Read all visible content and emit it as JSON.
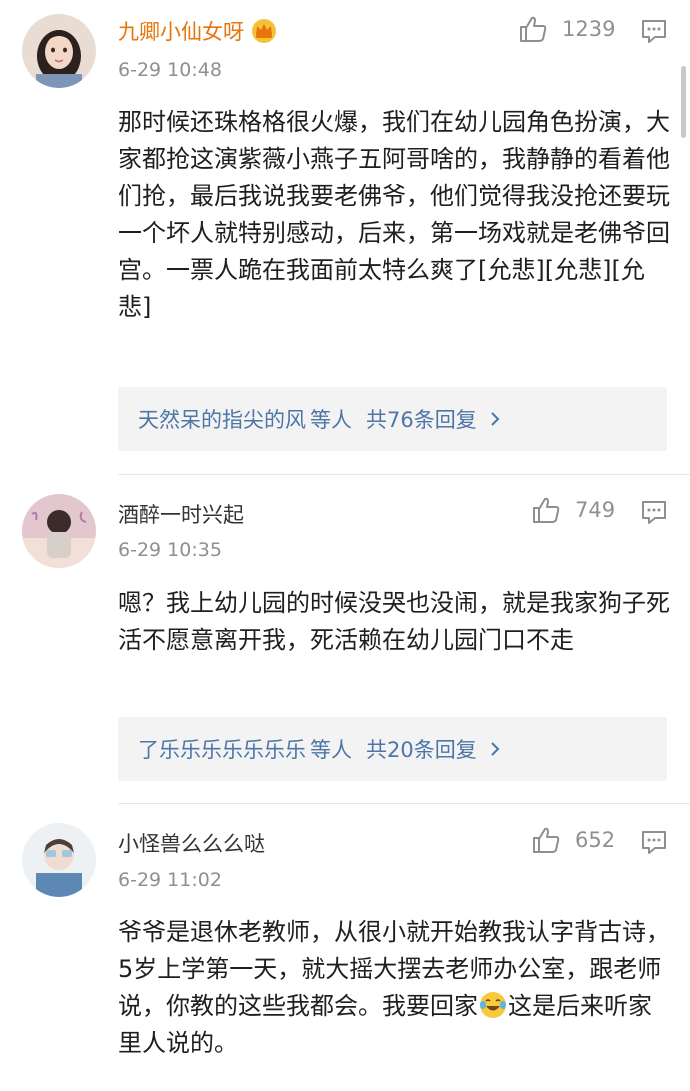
{
  "comments": [
    {
      "username": "九卿小仙女呀",
      "time": "6-29 10:48",
      "likes": "1239",
      "text": "那时候还珠格格很火爆，我们在幼儿园角色扮演，大家都抢这演紫薇小燕子五阿哥啥的，我静静的看着他们抢，最后我说我要老佛爷，他们觉得我没抢还要玩一个坏人就特别感动，后来，第一场戏就是老佛爷回宫。一票人跪在我面前太特么爽了[允悲][允悲][允悲]",
      "replies": {
        "who": "天然呆的指尖的风",
        "suffix": "等人",
        "count": "共76条回复"
      }
    },
    {
      "username": "酒醉一时兴起",
      "time": "6-29 10:35",
      "likes": "749",
      "text": "嗯？我上幼儿园的时候没哭也没闹，就是我家狗子死活不愿意离开我，死活赖在幼儿园门口不走",
      "replies": {
        "who": "了乐乐乐乐乐乐乐",
        "suffix": "等人",
        "count": "共20条回复"
      }
    },
    {
      "username": "小怪兽么么么哒",
      "time": "6-29 11:02",
      "likes": "652",
      "text_before_emoji": "爷爷是退休老教师，从很小就开始教我认字背古诗，5岁上学第一天，就大摇大摆去老师办公室，跟老师说，你教的这些我都会。我要回家",
      "text_after_emoji": "这是后来听家里人说的。"
    }
  ],
  "icons": {
    "vip": "crown-icon",
    "like": "thumb-up-icon",
    "reply": "comment-icon",
    "more": "chevron-right-icon",
    "emoji": "laughing-tears-emoji"
  },
  "colors": {
    "vip_name": "#e8740c",
    "link": "#4d76a8",
    "meta": "#8f8f8f"
  }
}
